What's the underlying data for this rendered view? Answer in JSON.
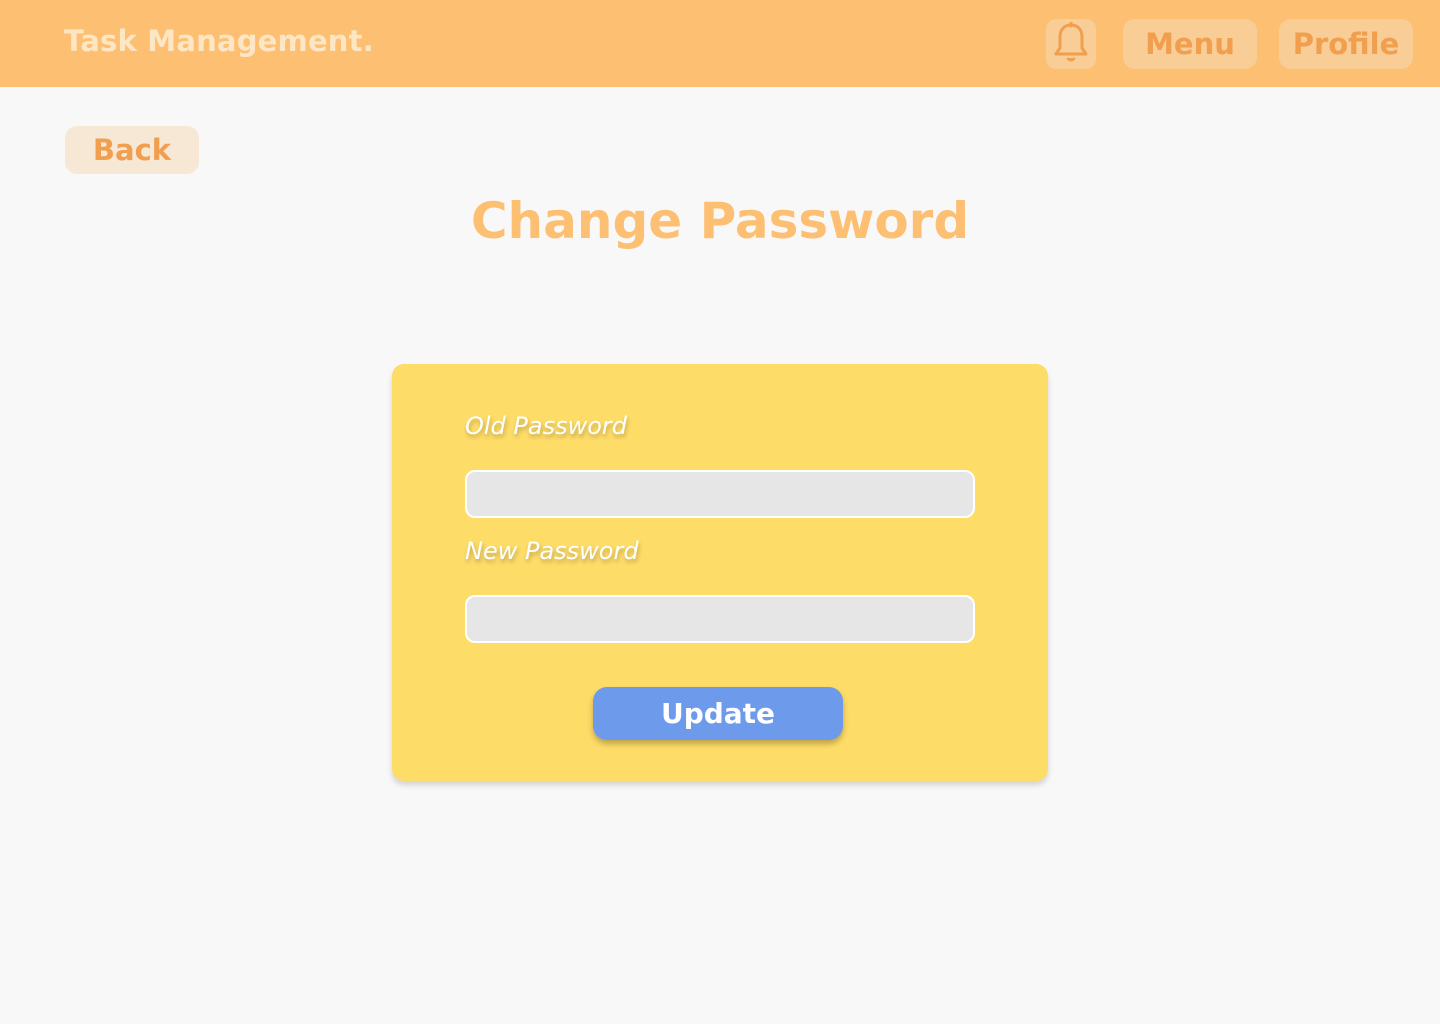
{
  "header": {
    "brand": "Task Management.",
    "bell_icon": "bell-icon",
    "menu_label": "Menu",
    "profile_label": "Profile"
  },
  "nav": {
    "back_label": "Back"
  },
  "page": {
    "title": "Change Password"
  },
  "form": {
    "old_password_label": "Old Password",
    "old_password_value": "",
    "new_password_label": "New Password",
    "new_password_value": "",
    "submit_label": "Update"
  },
  "colors": {
    "header_bg": "#fdbf72",
    "brand_text": "#fde6c4",
    "button_bg": "#f9cd96",
    "button_text": "#f19e4f",
    "card_bg": "#fedc68",
    "input_bg": "#e6e6e6",
    "primary_button": "#6e9aec",
    "page_bg": "#f8f8f8"
  }
}
